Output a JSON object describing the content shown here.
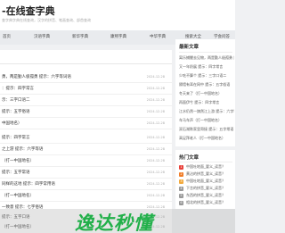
{
  "header": {
    "site_title": "-在线查字典",
    "subtitle": "查字典字典在线查询，汉字的拼音、笔画查询、部首查询"
  },
  "nav": {
    "items": [
      "首页",
      "汉语字典",
      "新华字典",
      "康熙字典",
      "中华字典",
      "搜索大全",
      "学会问答"
    ]
  },
  "main": {
    "rows": [
      {
        "text": "勇，两是勤人极孤勇 提示：六字等词语",
        "date": "2024-12-28"
      },
      {
        "text": "：提示：四字常言",
        "date": "2024-12-28"
      },
      {
        "text": "示：三字口语二",
        "date": "2024-12-28"
      },
      {
        "text": "提示：五字俗语",
        "date": "2024-12-28"
      },
      {
        "text": "中国地名）",
        "date": "2024-12-28"
      },
      {
        "text": "提示：四字常言",
        "date": "2024-12-28"
      },
      {
        "text": "之上游 提示：六字等语",
        "date": "2024-12-28"
      },
      {
        "text": "（打一中国地名）",
        "date": "2024-12-28"
      },
      {
        "text": "提示：五字常语",
        "date": "2024-12-28"
      },
      {
        "text": "同样的这地 提示：四字常用语",
        "date": "2024-12-28"
      },
      {
        "text": "（打一中国地名）",
        "date": "2024-12-28"
      },
      {
        "text": "一致意 提示：七字俗语",
        "date": "2024-12-28"
      },
      {
        "text": "提示：五字口语",
        "date": "2024-12-28"
      },
      {
        "text": "（打一中国地名）",
        "date": "2024-12-28"
      }
    ]
  },
  "sidebar": {
    "latest_title": "最新文章",
    "latest": [
      "离乐捕鲤去见物，两是勤人极孤勇 提示",
      "又一年奶展 提示：四字常言",
      "少吃不算个 提示：三字口语二",
      "隔墙有耳在网中 提示：五字俗语",
      "冬天来了（打一中国地名）",
      "再面伊兮 提示：四字常言",
      "江水仍然一旗然江上游 提示：六字等语",
      "车马车声（打一中国地名）",
      "双石湖陈家里哥接 提示：五字常语",
      "高足拜老人（打一中国地名）"
    ],
    "hot_title": "热门文章",
    "hot": [
      {
        "num": "1",
        "text": "中国吐地面_要义_读音？",
        "color": "#e8403a"
      },
      {
        "num": "2",
        "text": "黄沾的拼音_要义_读音？",
        "color": "#f07c27"
      },
      {
        "num": "3",
        "text": "中国吐地面_要义_读音？",
        "color": "#f2a93b"
      },
      {
        "num": "4",
        "text": "下言的拼音_要义_读音？",
        "color": "#999999"
      },
      {
        "num": "5",
        "text": "东西的拼音_要义_读音？",
        "color": "#999999"
      },
      {
        "num": "6",
        "text": "相北的拼音_要义_读音？",
        "color": "#999999"
      }
    ]
  },
  "banner": {
    "text": "逸达秒懂"
  }
}
